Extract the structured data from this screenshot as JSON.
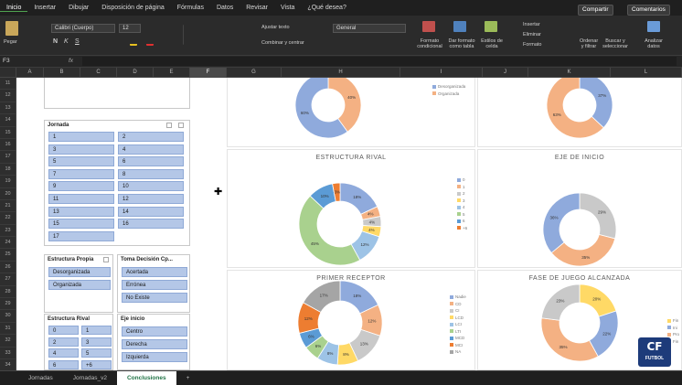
{
  "menu": [
    "Inicio",
    "Insertar",
    "Dibujar",
    "Disposición de página",
    "Fórmulas",
    "Datos",
    "Revisar",
    "Vista",
    "¿Qué desea?"
  ],
  "share_label": "Compartir",
  "comments_label": "Comentarios",
  "ribbon": {
    "paste": "Pegar",
    "font_name": "Calibri (Cuerpo)",
    "font_size": "12",
    "wrap": "Ajustar texto",
    "merge": "Combinar y centrar",
    "number_format": "General",
    "cond_format": "Formato condicional",
    "format_table": "Dar formato como tabla",
    "cell_styles": "Estilos de celda",
    "insert": "Insertar",
    "delete": "Eliminar",
    "format": "Formato",
    "sort": "Ordenar y filtrar",
    "find": "Buscar y seleccionar",
    "analyze": "Analizar datos"
  },
  "name_box": "F3",
  "fx": "fx",
  "columns": [
    "A",
    "B",
    "C",
    "D",
    "E",
    "F",
    "G",
    "H",
    "I",
    "J",
    "K",
    "L"
  ],
  "rows": [
    "11",
    "12",
    "13",
    "14",
    "15",
    "16",
    "17",
    "18",
    "19",
    "20",
    "21",
    "22",
    "23",
    "24",
    "25",
    "26",
    "27",
    "28",
    "29",
    "30",
    "31",
    "32",
    "33",
    "34"
  ],
  "slicers": {
    "jornada": {
      "title": "Jornada",
      "items": [
        "1",
        "2",
        "3",
        "4",
        "5",
        "6",
        "7",
        "8",
        "9",
        "10",
        "11",
        "12",
        "13",
        "14",
        "15",
        "16",
        "17"
      ]
    },
    "estructura_propia": {
      "title": "Estructura Propia",
      "items": [
        "Desorganizada",
        "Organizada"
      ]
    },
    "toma_decision": {
      "title": "Toma Decisión Cp...",
      "items": [
        "Acertada",
        "Errónea",
        "No Existe"
      ]
    },
    "estructura_rival": {
      "title": "Estructura Rival",
      "items": [
        "0",
        "1",
        "2",
        "3",
        "4",
        "5",
        "6",
        "+6"
      ]
    },
    "eje_inicio": {
      "title": "Eje inicio",
      "items": [
        "Centro",
        "Derecha",
        "Izquierda"
      ]
    }
  },
  "charts": {
    "estructura_rival": "ESTRUCTURA RIVAL",
    "eje_inicio": "EJE DE INICIO",
    "primer_receptor": "PRIMER RECEPTOR",
    "fase_juego": "FASE DE JUEGO ALCANZADA",
    "top_left_legend": [
      "Desorganizada",
      "Organizada"
    ]
  },
  "chart_data": [
    {
      "type": "pie",
      "title": "",
      "categories": [
        "",
        ""
      ],
      "values": [
        40,
        60
      ],
      "labels": [
        "40%",
        "60%"
      ]
    },
    {
      "type": "pie",
      "title": "",
      "categories": [
        "",
        ""
      ],
      "values": [
        37,
        63
      ],
      "labels": [
        "37%",
        "63%"
      ]
    },
    {
      "type": "pie",
      "title": "ESTRUCTURA RIVAL",
      "categories": [
        "0",
        "1",
        "2",
        "3",
        "4",
        "5",
        "6",
        "+6"
      ],
      "values": [
        18,
        4,
        4,
        4,
        12,
        45,
        10,
        3
      ],
      "labels": [
        "18%",
        "4%",
        "4%",
        "4%",
        "12%",
        "45%",
        "10%",
        "3%"
      ]
    },
    {
      "type": "pie",
      "title": "EJE DE INICIO",
      "categories": [
        "Centro",
        "Derecha",
        "Izquierda"
      ],
      "values": [
        29,
        35,
        36
      ],
      "labels": [
        "29%",
        "35%",
        "36%"
      ]
    },
    {
      "type": "pie",
      "title": "PRIMER RECEPTOR",
      "categories": [
        "Nadie",
        "CD",
        "CI",
        "LCD",
        "LCI",
        "LTI",
        "MCD",
        "MCI",
        "NA"
      ],
      "values": [
        18,
        12,
        13,
        8,
        8,
        6,
        6,
        12,
        17
      ],
      "labels": [
        "18%",
        "12%",
        "13%",
        "8%",
        "8%",
        "6%",
        "6%",
        "12%",
        "17%"
      ]
    },
    {
      "type": "pie",
      "title": "FASE DE JUEGO ALCANZADA",
      "categories": [
        "Fin",
        "Ini",
        "Pro",
        "Fin"
      ],
      "values": [
        20,
        22,
        35,
        23
      ],
      "labels": [
        "20%",
        "22%",
        "35%",
        "23%"
      ]
    }
  ],
  "logo_text": "FUTBOL",
  "sheet_tabs": [
    "Jornadas",
    "Jornadas_v2",
    "Conclusiones"
  ],
  "active_tab": "Conclusiones"
}
